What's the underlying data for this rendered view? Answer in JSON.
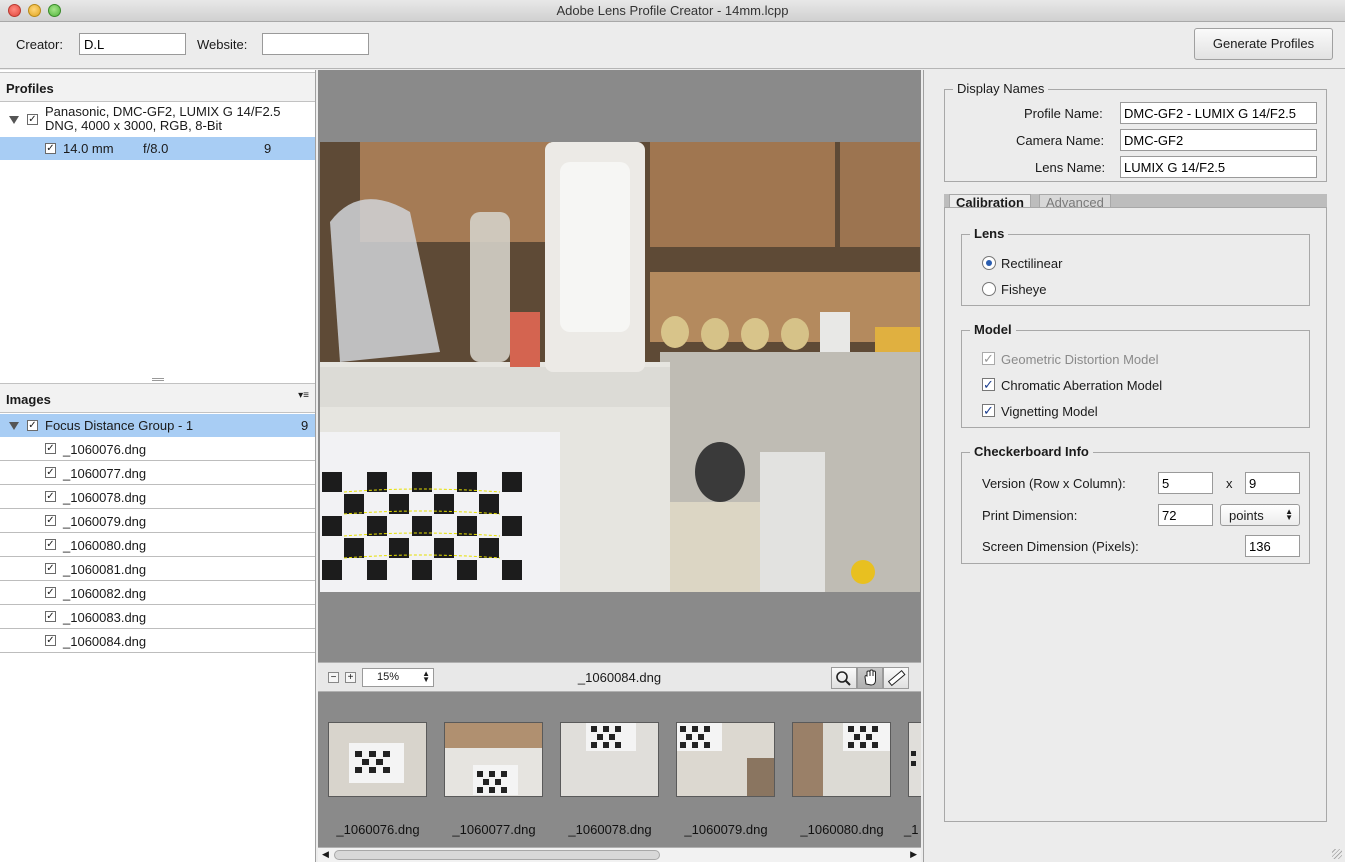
{
  "window": {
    "title": "Adobe Lens Profile Creator - 14mm.lcpp"
  },
  "toolbar": {
    "creator_label": "Creator:",
    "creator_value": "D.L",
    "website_label": "Website:",
    "website_value": "",
    "generate_label": "Generate Profiles"
  },
  "profiles": {
    "header": "Profiles",
    "camera_line1": "Panasonic, DMC-GF2, LUMIX G 14/F2.5",
    "camera_line2": "DNG, 4000 x 3000, RGB, 8-Bit",
    "profile_focal": "14.0 mm",
    "profile_aperture": "f/8.0",
    "profile_count": "9"
  },
  "images": {
    "header": "Images",
    "group_label": "Focus Distance Group - 1",
    "group_count": "9",
    "files": [
      "_1060076.dng",
      "_1060077.dng",
      "_1060078.dng",
      "_1060079.dng",
      "_1060080.dng",
      "_1060081.dng",
      "_1060082.dng",
      "_1060083.dng",
      "_1060084.dng"
    ]
  },
  "viewer": {
    "zoom": "15%",
    "current_file": "_1060084.dng",
    "tools": [
      "zoom-icon",
      "hand-icon",
      "ruler-icon"
    ]
  },
  "filmstrip": {
    "thumbs": [
      "_1060076.dng",
      "_1060077.dng",
      "_1060078.dng",
      "_1060079.dng",
      "_1060080.dng",
      "_1"
    ]
  },
  "display_names": {
    "title": "Display Names",
    "profile_name_label": "Profile Name:",
    "profile_name": "DMC-GF2 - LUMIX G 14/F2.5",
    "camera_name_label": "Camera Name:",
    "camera_name": "DMC-GF2",
    "lens_name_label": "Lens Name:",
    "lens_name": "LUMIX G 14/F2.5"
  },
  "tabs": {
    "calibration": "Calibration",
    "advanced": "Advanced"
  },
  "lens": {
    "title": "Lens",
    "rectilinear": "Rectilinear",
    "fisheye": "Fisheye",
    "selected": "Rectilinear"
  },
  "model": {
    "title": "Model",
    "geometric": "Geometric Distortion Model",
    "chromatic": "Chromatic Aberration Model",
    "vignetting": "Vignetting Model"
  },
  "checkerboard": {
    "title": "Checkerboard Info",
    "version_label": "Version (Row x Column):",
    "rows": "5",
    "x_label": "x",
    "columns": "9",
    "print_label": "Print Dimension:",
    "print_value": "72",
    "print_unit": "points",
    "screen_label": "Screen Dimension (Pixels):",
    "screen_value": "136"
  },
  "colors": {
    "selection": "#a8cdf4",
    "radio_accent": "#2a5db0"
  }
}
